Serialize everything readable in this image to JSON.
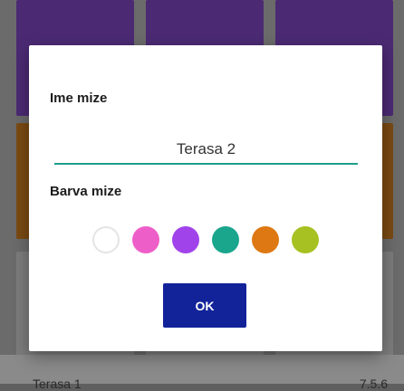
{
  "dialog": {
    "name_label": "Ime mize",
    "name_value": "Terasa 2",
    "color_label": "Barva mize",
    "ok_label": "OK",
    "colors": [
      {
        "name": "white",
        "hex": "#ffffff"
      },
      {
        "name": "pink",
        "hex": "#ee5ec8"
      },
      {
        "name": "purple",
        "hex": "#a143ea"
      },
      {
        "name": "teal",
        "hex": "#1aa58d"
      },
      {
        "name": "orange",
        "hex": "#dd7812"
      },
      {
        "name": "olive",
        "hex": "#a6c121"
      }
    ]
  },
  "background": {
    "bottom_left_text": "Terasa 1",
    "bottom_right_text": "7.5.6"
  }
}
